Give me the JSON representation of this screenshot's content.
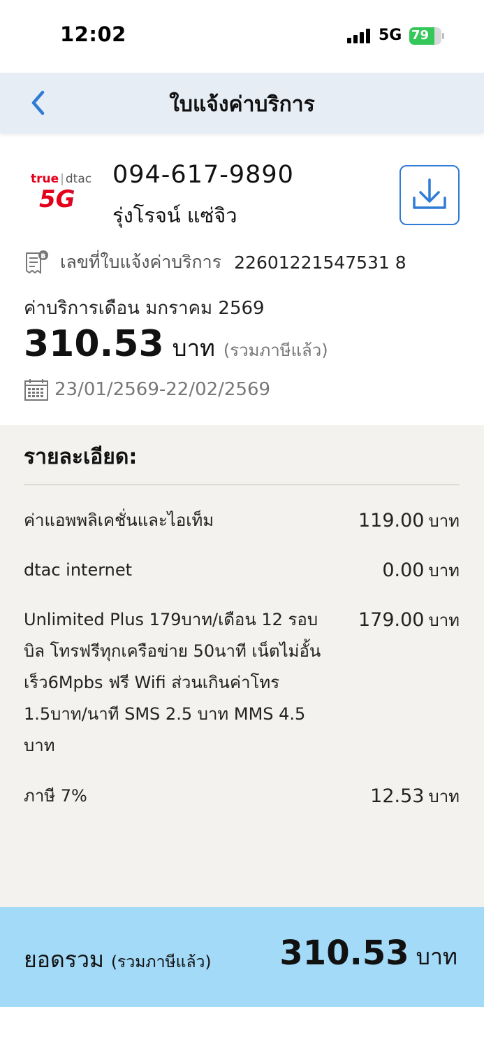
{
  "status_bar": {
    "time": "12:02",
    "network": "5G",
    "battery_percent": "79",
    "battery_level": 0.79
  },
  "header": {
    "title": "ใบแจ้งค่าบริการ",
    "back_icon": "chevron-left-icon"
  },
  "account": {
    "brand_true": "true",
    "brand_dtac": "dtac",
    "brand_5g": "5G",
    "phone_number": "094-617-9890",
    "customer_name": "รุ่งโรจน์ แซ่จิว",
    "download_icon": "download-icon"
  },
  "bill": {
    "number_label": "เลขที่ใบแจ้งค่าบริการ",
    "number_value": "22601221547531 8",
    "month_label": "ค่าบริการเดือน มกราคม 2569",
    "amount": "310.53",
    "amount_unit": "บาท",
    "amount_note": "(รวมภาษีแล้ว)",
    "period": "23/01/2569-22/02/2569"
  },
  "details": {
    "title": "รายละเอียด:",
    "items": [
      {
        "name": "ค่าแอพพลิเคชั่นและไอเท็ม",
        "amount": "119.00",
        "unit": "บาท"
      },
      {
        "name": "dtac internet",
        "amount": "0.00",
        "unit": "บาท"
      },
      {
        "name": "Unlimited Plus 179บาท/เดือน 12 รอบบิล โทรฟรีทุกเครือข่าย 50นาที เน็ตไม่อั้นเร็ว6Mpbs ฟรี Wifi ส่วนเกินค่าโทร 1.5บาท/นาที SMS 2.5 บาท MMS 4.5 บาท",
        "amount": "179.00",
        "unit": "บาท"
      },
      {
        "name": "ภาษี 7%",
        "amount": "12.53",
        "unit": "บาท"
      }
    ]
  },
  "total": {
    "label": "ยอดรวม",
    "note": "(รวมภาษีแล้ว)",
    "amount": "310.53",
    "unit": "บาท"
  },
  "colors": {
    "header_bg": "#e7edf4",
    "accent_blue": "#2f7bd6",
    "details_bg": "#f3f2ee",
    "total_bg": "#a3daf8",
    "brand_red": "#e3001b",
    "battery_green": "#34c759"
  }
}
